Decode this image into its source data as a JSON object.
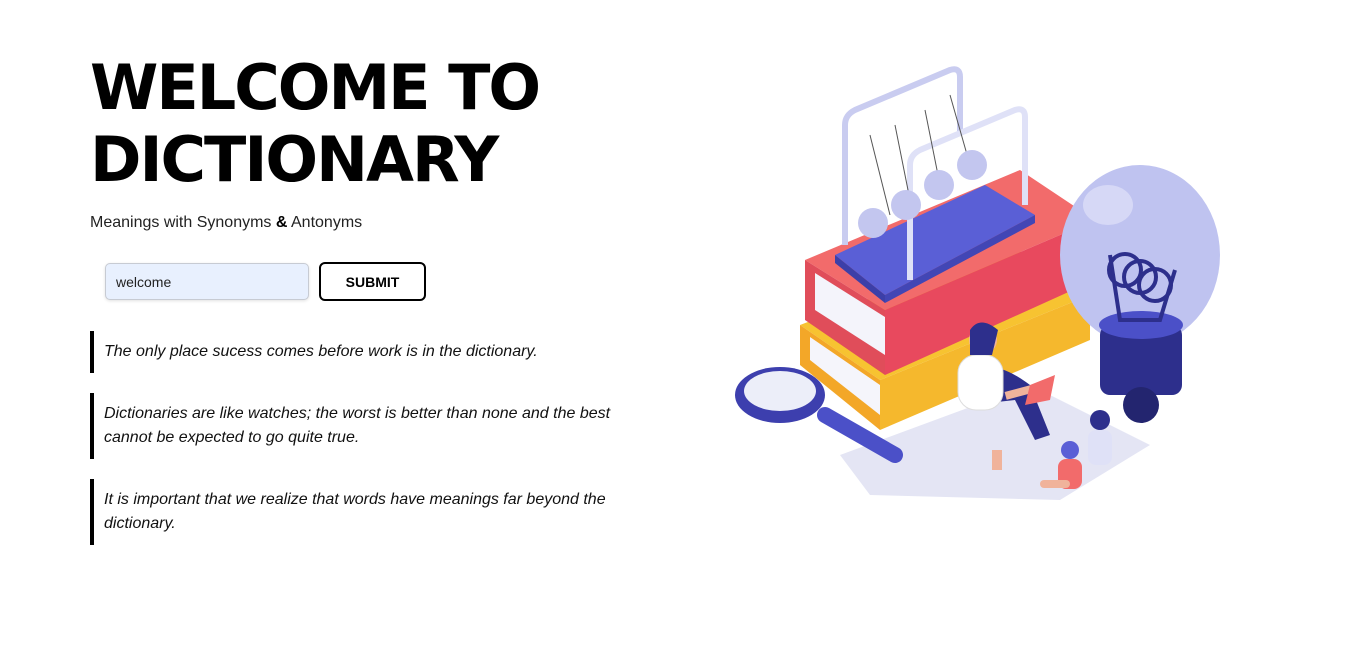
{
  "hero": {
    "title_line1": "WELCOME TO",
    "title_line2": "DICTIONARY",
    "subtitle_part1": "Meanings with Synonyms",
    "subtitle_amp": "&",
    "subtitle_part2": "Antonyms"
  },
  "search": {
    "value": "welcome",
    "submit_label": "SUBMIT"
  },
  "quotes": [
    "The only place sucess comes before work is in the dictionary.",
    "Dictionaries are like watches; the worst is better than none and the best cannot be expected to go quite true.",
    "It is important that we realize that words have meanings far beyond the dictionary."
  ],
  "colors": {
    "accent_purple": "#5a5fd6",
    "book_red": "#f26b6b",
    "book_yellow": "#f7c331",
    "bulb": "#bfc3f0"
  }
}
